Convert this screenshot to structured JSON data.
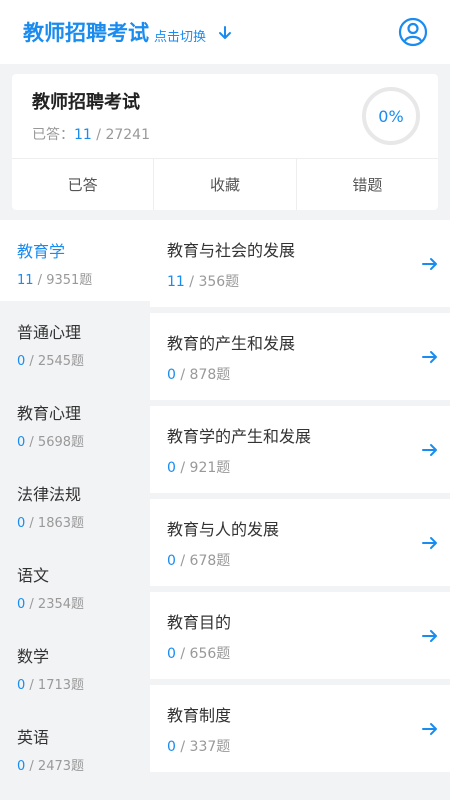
{
  "header": {
    "title": "教师招聘考试",
    "switch_label": "点击切换"
  },
  "summary": {
    "title": "教师招聘考试",
    "answered_label": "已答：",
    "answered": "11",
    "total": "/ 27241",
    "progress": "0%"
  },
  "tabs": [
    {
      "label": "已答"
    },
    {
      "label": "收藏"
    },
    {
      "label": "错题"
    }
  ],
  "sidebar": [
    {
      "name": "教育学",
      "done": "11",
      "total": " / 9351题"
    },
    {
      "name": "普通心理",
      "done": "0",
      "total": " / 2545题"
    },
    {
      "name": "教育心理",
      "done": "0",
      "total": " / 5698题"
    },
    {
      "name": "法律法规",
      "done": "0",
      "total": " / 1863题"
    },
    {
      "name": "语文",
      "done": "0",
      "total": " / 2354题"
    },
    {
      "name": "数学",
      "done": "0",
      "total": " / 1713题"
    },
    {
      "name": "英语",
      "done": "0",
      "total": " / 2473题"
    }
  ],
  "chapters": [
    {
      "name": "教育与社会的发展",
      "done": "11",
      "total": " / 356题"
    },
    {
      "name": "教育的产生和发展",
      "done": "0",
      "total": " / 878题"
    },
    {
      "name": "教育学的产生和发展",
      "done": "0",
      "total": " / 921题"
    },
    {
      "name": "教育与人的发展",
      "done": "0",
      "total": " / 678题"
    },
    {
      "name": "教育目的",
      "done": "0",
      "total": " / 656题"
    },
    {
      "name": "教育制度",
      "done": "0",
      "total": " / 337题"
    }
  ],
  "colors": {
    "accent": "#1a8cf0"
  },
  "icons": {
    "switch": "arrow-down-icon",
    "profile": "user-circle-icon",
    "chapter": "arrow-right-icon"
  }
}
